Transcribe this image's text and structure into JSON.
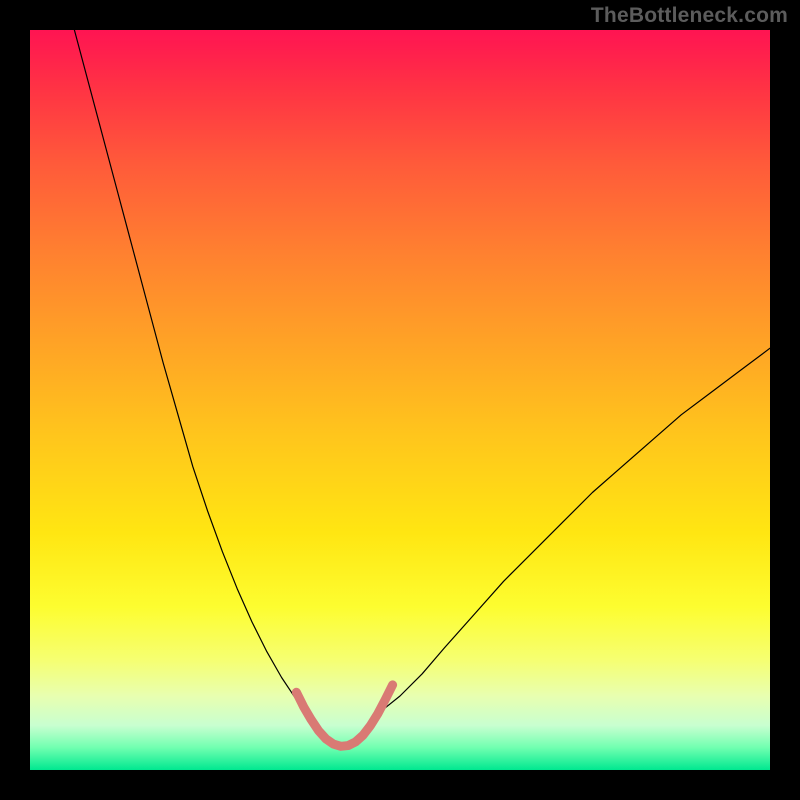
{
  "watermark": "TheBottleneck.com",
  "chart_data": {
    "type": "line",
    "title": "",
    "xlabel": "",
    "ylabel": "",
    "xlim": [
      0,
      100
    ],
    "ylim": [
      0,
      100
    ],
    "grid": false,
    "legend": false,
    "description": "Bottleneck-style V-curve. Two steep black curves descending from upper-left and upper-right toward a flat minimum region; the minimum valley is highlighted by a thick salmon U-shaped overlay.",
    "series": [
      {
        "name": "left-curve",
        "color": "#000000",
        "stroke": 1.2,
        "x": [
          6,
          8,
          10,
          12,
          14,
          16,
          18,
          20,
          22,
          24,
          26,
          28,
          30,
          32,
          34,
          36,
          37.5
        ],
        "values": [
          100,
          92.5,
          85,
          77.5,
          70,
          62.5,
          55,
          48,
          41,
          35,
          29.5,
          24.5,
          20,
          16,
          12.5,
          9.5,
          8
        ]
      },
      {
        "name": "right-curve",
        "color": "#000000",
        "stroke": 1.2,
        "x": [
          47.5,
          50,
          53,
          56,
          60,
          64,
          68,
          72,
          76,
          80,
          84,
          88,
          92,
          96,
          100
        ],
        "values": [
          8,
          10,
          13,
          16.5,
          21,
          25.5,
          29.5,
          33.5,
          37.5,
          41,
          44.5,
          48,
          51,
          54,
          57
        ]
      },
      {
        "name": "valley-highlight",
        "color": "#d97a74",
        "stroke": 9,
        "x": [
          36,
          37,
          38,
          39,
          40,
          41,
          42,
          43,
          44,
          45,
          46,
          47,
          48,
          49
        ],
        "values": [
          10.5,
          8.5,
          6.8,
          5.3,
          4.2,
          3.5,
          3.2,
          3.3,
          3.8,
          4.7,
          6.0,
          7.6,
          9.5,
          11.5
        ]
      }
    ]
  }
}
